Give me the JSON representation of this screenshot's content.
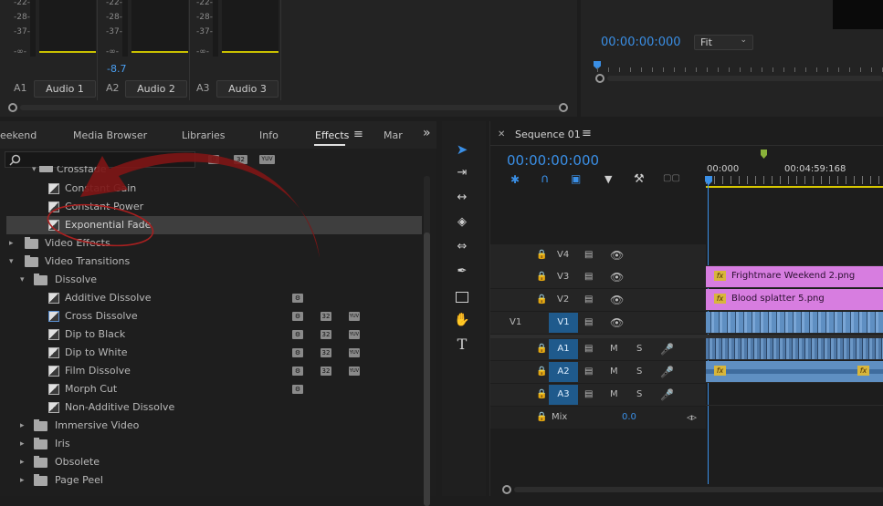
{
  "mixer": {
    "db_marks": [
      "-22-",
      "-28-",
      "-37-",
      "-∞-"
    ],
    "peak_value": "-8.7",
    "channels": [
      {
        "id": "A1",
        "name": "Audio 1"
      },
      {
        "id": "A2",
        "name": "Audio 2"
      },
      {
        "id": "A3",
        "name": "Audio 3"
      }
    ]
  },
  "program": {
    "timecode": "00:00:00:000",
    "zoom": "Fit"
  },
  "effects_panel": {
    "tabs": [
      {
        "label": "eekend"
      },
      {
        "label": "Media Browser"
      },
      {
        "label": "Libraries"
      },
      {
        "label": "Info"
      },
      {
        "label": "Effects"
      },
      {
        "label": "Mar"
      }
    ],
    "search_placeholder": "",
    "badges": {
      "accel": "⚙",
      "b32": "32",
      "yuv": "YUV"
    },
    "items": {
      "crossfade": "Crossfade",
      "constant_gain": "Constant Gain",
      "constant_power": "Constant Power",
      "exponential_fade": "Exponential Fade",
      "video_effects": "Video Effects",
      "video_transitions": "Video Transitions",
      "dissolve": "Dissolve",
      "additive_dissolve": "Additive Dissolve",
      "cross_dissolve": "Cross Dissolve",
      "dip_to_black": "Dip to Black",
      "dip_to_white": "Dip to White",
      "film_dissolve": "Film Dissolve",
      "morph_cut": "Morph Cut",
      "non_additive_dissolve": "Non-Additive Dissolve",
      "immersive_video": "Immersive Video",
      "iris": "Iris",
      "obsolete": "Obsolete",
      "page_peel": "Page Peel"
    }
  },
  "timeline": {
    "sequence_name": "Sequence 01",
    "timecode": "00:00:00:000",
    "ruler": [
      "00:000",
      "00:04:59:168"
    ],
    "tracks": {
      "v4": "V4",
      "v3": "V3",
      "v2": "V2",
      "v1": "V1",
      "v1_source": "V1",
      "a1": "A1",
      "a2": "A2",
      "a3": "A3",
      "m": "M",
      "s": "S",
      "mix": "Mix",
      "mix_value": "0.0"
    },
    "clips": {
      "v3": "Frightmare Weekend 2.png",
      "v2": "Blood splatter 5.png",
      "fx": "fx"
    }
  },
  "colors": {
    "accent_blue": "#3a8fe6",
    "clip_pink": "#d77de0",
    "clip_blue": "#5f8fc2",
    "fx_badge": "#d8b63b",
    "annotation_red": "#8b1a1a"
  }
}
